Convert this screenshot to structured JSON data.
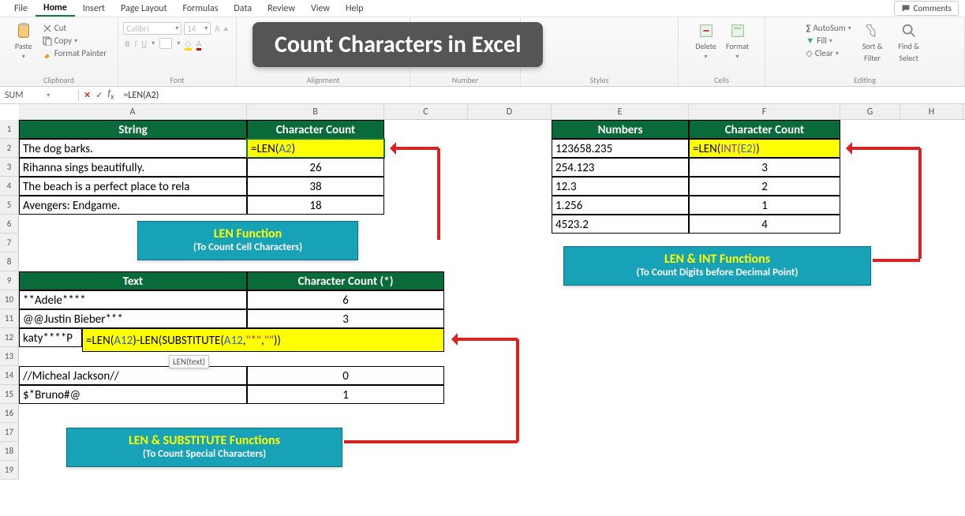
{
  "menu": {
    "items": [
      "File",
      "Home",
      "Insert",
      "Page Layout",
      "Formulas",
      "Data",
      "Review",
      "View",
      "Help"
    ],
    "active": "Home",
    "comments": "Comments"
  },
  "ribbon": {
    "clipboard": {
      "paste": "Paste",
      "cut": "Cut",
      "copy": "Copy",
      "format_painter": "Format Painter",
      "label": "Clipboard"
    },
    "font": {
      "family": "Calibri",
      "size": "14",
      "label": "Font"
    },
    "alignment": {
      "label": "Alignment"
    },
    "number": {
      "label": "Number"
    },
    "styles": {
      "label": "Styles"
    },
    "cells": {
      "delete": "Delete",
      "format": "Format",
      "label": "Cells"
    },
    "editing": {
      "autosum": "AutoSum",
      "fill": "Fill",
      "clear": "Clear",
      "sort": "Sort &",
      "filter": "Filter",
      "find": "Find &",
      "select": "Select",
      "label": "Editing"
    }
  },
  "title_badge": "Count Characters in Excel",
  "formula_bar": {
    "name_box": "SUM",
    "formula": "=LEN(A2)"
  },
  "columns": [
    "A",
    "B",
    "C",
    "D",
    "E",
    "F",
    "G",
    "H"
  ],
  "rows": [
    "1",
    "2",
    "3",
    "4",
    "5",
    "6",
    "7",
    "8",
    "9",
    "10",
    "11",
    "12",
    "13",
    "14",
    "15",
    "16",
    "17",
    "18",
    "19"
  ],
  "table1": {
    "headers": [
      "String",
      "Character Count"
    ],
    "cells": {
      "A2": "The dog barks.",
      "B2": "=LEN(A2)",
      "A3": "Rihanna sings beautifully.",
      "B3": "26",
      "A4": "The beach is a perfect place to rela",
      "B4": "38",
      "A5": "Avengers: Endgame.",
      "B5": "18"
    }
  },
  "table2": {
    "headers": [
      "Text",
      "Character Count (*)"
    ],
    "cells": {
      "A10": "**Adele****",
      "B10": "6",
      "A11": " @@Justin Bieber***",
      "B11": "3",
      "A12": "katy****P",
      "B12_formula": "=LEN(A12)-LEN(SUBSTITUTE(A12,\"*\",\"\"))",
      "A14": "//Micheal Jackson//",
      "B14": "0",
      "A15": "$*Bruno#@",
      "B15": "1"
    }
  },
  "table3": {
    "headers": [
      "Numbers",
      "Character Count"
    ],
    "cells": {
      "E2": "123658.235",
      "F2": "=LEN(INT(E2))",
      "E3": "254.123",
      "F3": "3",
      "E4": "12.3",
      "F4": "2",
      "E5": "1.256",
      "F5": "1",
      "E6": "4523.2",
      "F6": "4"
    }
  },
  "callouts": {
    "c1": {
      "title": "LEN Function",
      "sub": "(To Count Cell Characters)"
    },
    "c2": {
      "title": "LEN & SUBSTITUTE Functions",
      "sub": "(To Count Special Characters)"
    },
    "c3": {
      "title": "LEN & INT Functions",
      "sub": "(To Count Digits before Decimal Point)"
    }
  },
  "tooltip": "LEN(text)"
}
